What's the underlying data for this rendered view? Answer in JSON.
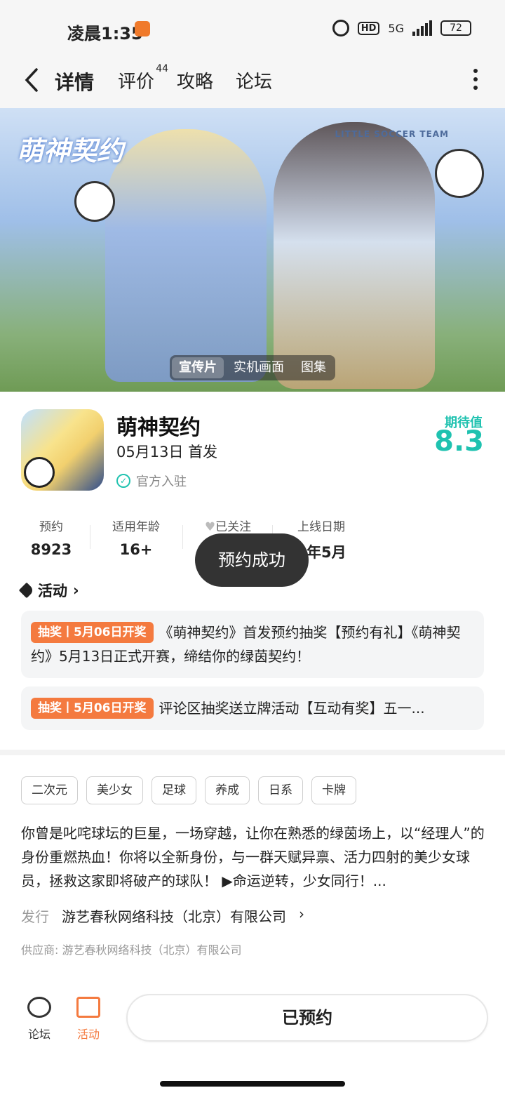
{
  "status": {
    "time": "凌晨1:35",
    "hd": "HD",
    "network": "5G",
    "battery": "72"
  },
  "header": {
    "tabs": [
      {
        "label": "详情"
      },
      {
        "label": "评价",
        "count": "44"
      },
      {
        "label": "攻略"
      },
      {
        "label": "论坛"
      }
    ]
  },
  "banner": {
    "logo_text": "萌神契约",
    "team_text": "LITTLE SOCCER TEAM",
    "media_tabs": [
      "宣传片",
      "实机画面",
      "图集"
    ]
  },
  "game": {
    "title": "萌神契约",
    "release": "05月13日 首发",
    "official": "官方入驻",
    "score_label": "期待值",
    "score": "8.3"
  },
  "stats": [
    {
      "k": "预约",
      "v": "8923"
    },
    {
      "k": "适用年龄",
      "v": "16+"
    },
    {
      "k": "已关注",
      "v": ""
    },
    {
      "k": "上线日期",
      "v": "6年5月"
    }
  ],
  "toast": "预约成功",
  "activity": {
    "heading": "活动",
    "items": [
      {
        "badge": "抽奖丨5月06日开奖",
        "text": "《萌神契约》首发预约抽奖【预约有礼】《萌神契约》5月13日正式开赛，缔结你的绿茵契约！"
      },
      {
        "badge": "抽奖丨5月06日开奖",
        "text": "评论区抽奖送立牌活动【互动有奖】五一..."
      }
    ]
  },
  "tags": [
    "二次元",
    "美少女",
    "足球",
    "养成",
    "日系",
    "卡牌"
  ],
  "description": "你曾是叱咤球坛的巨星，一场穿越，让你在熟悉的绿茵场上，以“经理人”的身份重燃热血！你将以全新身份，与一群天赋异禀、活力四射的美少女球员，拯救这家即将破产的球队！ ▶命运逆转，少女同行！...",
  "publisher": {
    "label": "发行",
    "name": "游艺春秋网络科技（北京）有限公司"
  },
  "supplier": "供应商: 游艺春秋网络科技（北京）有限公司",
  "bottom": {
    "forum": "论坛",
    "activity": "活动",
    "reserve": "已预约"
  },
  "colors": {
    "accent": "#1fc2b0",
    "orange": "#f47a3f"
  }
}
